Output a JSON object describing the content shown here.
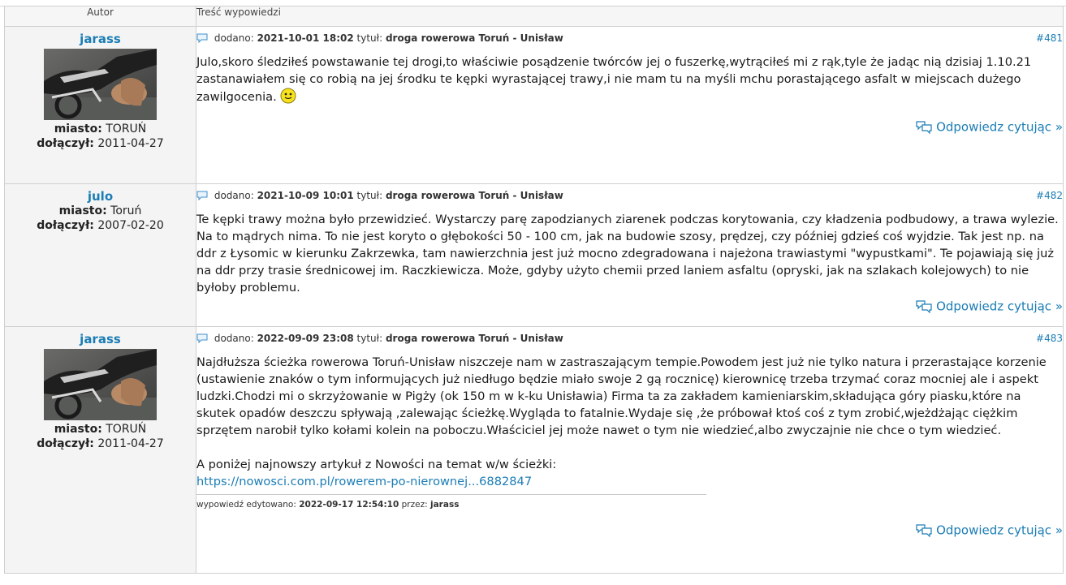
{
  "header": {
    "author_col": "Autor",
    "content_col": "Treść wypowiedzi"
  },
  "labels": {
    "added": "dodano:",
    "title": "tytuł:",
    "city": "miasto:",
    "joined": "dołączył:",
    "reply_quote": "Odpowiedz cytując »",
    "edited_by_prefix": "wypowiedź edytowano:",
    "edited_by_mid": "przez:"
  },
  "colors": {
    "link": "#1b7db5",
    "author_bg": "#f4f4f4"
  },
  "posts": [
    {
      "author": "jarass",
      "has_avatar": true,
      "city": "TORUŃ",
      "joined": "2011-04-27",
      "date": "2021-10-01 18:02",
      "title": "droga rowerowa Toruń - Unisław",
      "number": "#481",
      "body": "Julo,skoro śledziłeś powstawanie tej drogi,to właściwie posądzenie twórców jej o fuszerkę,wytrąciłeś mi z rąk,tyle że jadąc nią dzisiaj 1.10.21 zastanawiałem się co robią na jej środku te kępki wyrastającej trawy,i nie mam tu na myśli mchu porastającego asfalt w miejscach dużego zawilgocenia.",
      "smiley": "smiley-icon"
    },
    {
      "author": "julo",
      "has_avatar": false,
      "city": "Toruń",
      "joined": "2007-02-20",
      "date": "2021-10-09 10:01",
      "title": "droga rowerowa Toruń - Unisław",
      "number": "#482",
      "body": "Te kępki trawy można było przewidzieć. Wystarczy parę zapodzianych ziarenek podczas korytowania, czy kładzenia podbudowy, a trawa wylezie. Na to mądrych nima. To nie jest koryto o głębokości 50 - 100 cm, jak na budowie szosy, prędzej, czy później gdzieś coś wyjdzie. Tak jest np. na ddr z Łysomic w kierunku Zakrzewka, tam nawierzchnia jest już mocno zdegradowana i najeżona trawiastymi \"wypustkami\". Te pojawiają się już na ddr przy trasie średnicowej im. Raczkiewicza. Może, gdyby użyto chemii przed laniem asfaltu (opryski, jak na szlakach kolejowych) to nie byłoby problemu."
    },
    {
      "author": "jarass",
      "has_avatar": true,
      "city": "TORUŃ",
      "joined": "2011-04-27",
      "date": "2022-09-09 23:08",
      "title": "droga rowerowa Toruń - Unisław",
      "number": "#483",
      "body": "Najdłuższa ścieżka rowerowa Toruń-Unisław niszczeje nam w zastraszającym tempie.Powodem jest już nie tylko natura i przerastające korzenie (ustawienie znaków o tym informujących już niedługo będzie miało swoje 2 gą rocznicę) kierownicę trzeba trzymać coraz mocniej ale i aspekt ludzki.Chodzi mi o skrzyżowanie w Pigży (ok 150 m w k-ku Unisławia) Firma ta za zakładem kamieniarskim,składująca góry piasku,które na skutek opadów deszczu spływają ,zalewając ścieżkę.Wygląda to fatalnie.Wydaje się ,że próbował ktoś coś z tym zrobić,wjeżdżając ciężkim sprzętem narobił tylko kołami kolein na poboczu.Właściciel jej może nawet o tym nie wiedzieć,albo zwyczajnie nie chce o tym wiedzieć.",
      "body2": "A poniżej najnowszy artykuł z Nowości na temat w/w ścieżki:",
      "link": "https://nowosci.com.pl/rowerem-po-nierownej...6882847",
      "edited_date": "2022-09-17 12:54:10",
      "edited_by": "jarass"
    }
  ]
}
